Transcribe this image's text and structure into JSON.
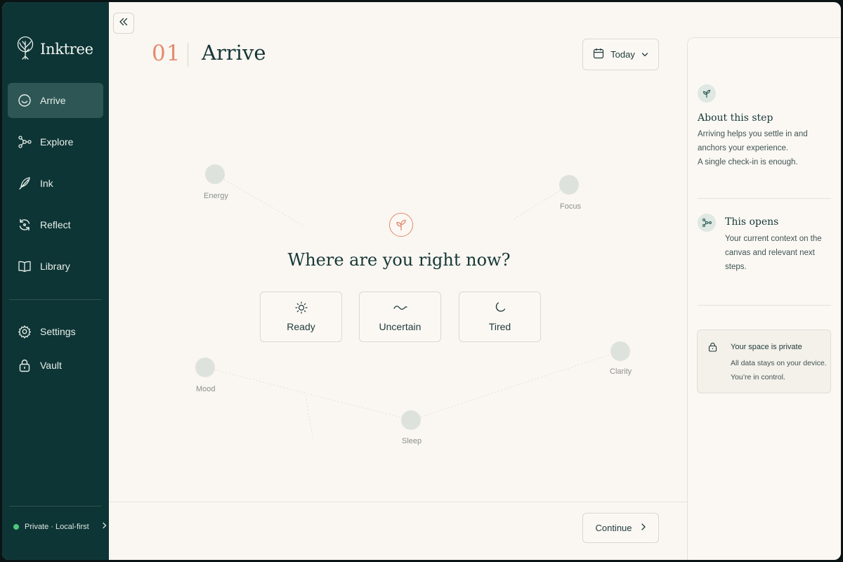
{
  "app": {
    "name": "Inktree"
  },
  "sidebar": {
    "items": [
      {
        "label": "Arrive",
        "icon": "arrive-icon",
        "active": true
      },
      {
        "label": "Explore",
        "icon": "explore-icon"
      },
      {
        "label": "Ink",
        "icon": "feather-icon"
      },
      {
        "label": "Reflect",
        "icon": "reflect-icon"
      },
      {
        "label": "Library",
        "icon": "book-icon"
      }
    ],
    "secondary": [
      {
        "label": "Settings",
        "icon": "gear-icon"
      },
      {
        "label": "Vault",
        "icon": "lock-icon"
      }
    ],
    "status": "Private · Local-first"
  },
  "header": {
    "step_number": "01",
    "title": "Arrive",
    "date_label": "Today"
  },
  "canvas": {
    "nodes": [
      "Energy",
      "Focus",
      "Mood",
      "Clarity",
      "Sleep"
    ],
    "question": "Where are you right now?",
    "choices": [
      {
        "label": "Ready",
        "icon": "sun-icon"
      },
      {
        "label": "Uncertain",
        "icon": "wave-icon"
      },
      {
        "label": "Tired",
        "icon": "moon-icon"
      }
    ]
  },
  "footer": {
    "continue_label": "Continue"
  },
  "panel": {
    "about_title": "About this step",
    "about_lines": [
      "Arriving helps you settle in and",
      "anchors your experience.",
      "A single check-in is enough."
    ],
    "opens_title": "This opens",
    "opens_lines": [
      "Your current context on the",
      "canvas and relevant next",
      "steps."
    ],
    "privacy_title": "Your space is private",
    "privacy_lines": [
      "All data stays on your device.",
      "You’re in control."
    ]
  },
  "colors": {
    "sidebar_bg": "#0e3535",
    "accent": "#e38a6e",
    "background": "#faf6f1",
    "status_green": "#4cc77a"
  }
}
